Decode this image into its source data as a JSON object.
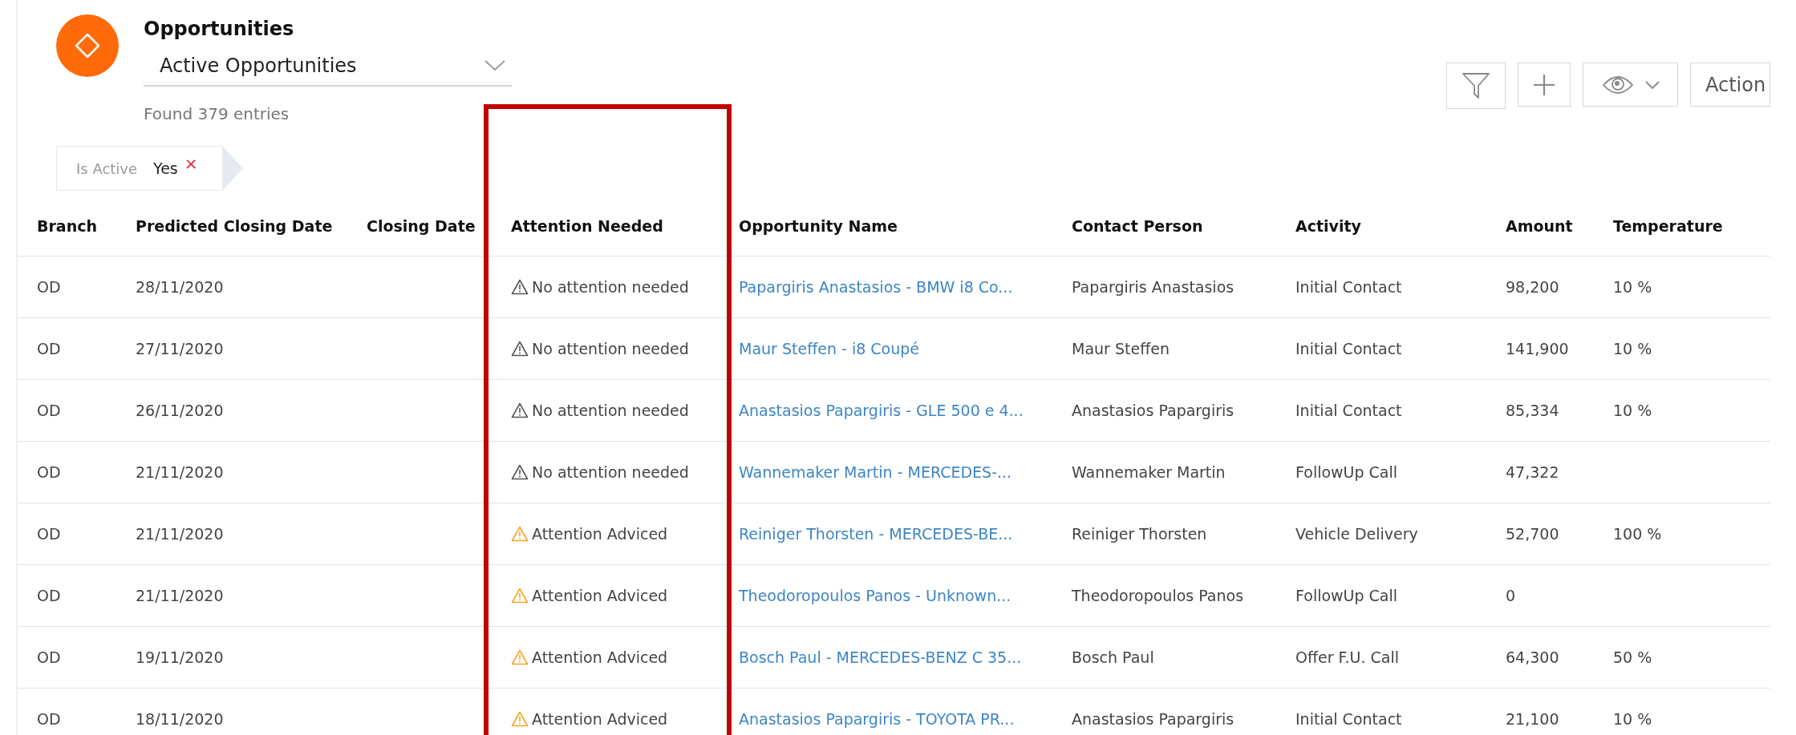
{
  "header": {
    "title": "Opportunities",
    "view": "Active Opportunities",
    "count": "Found 379 entries"
  },
  "toolbar": {
    "actions_label": "Action"
  },
  "filters": [
    {
      "label": "Is Active",
      "value": "Yes",
      "remove": "×"
    }
  ],
  "table": {
    "columns": [
      "Branch",
      "Predicted Closing Date",
      "Closing Date",
      "Attention Needed",
      "Opportunity Name",
      "Contact Person",
      "Activity",
      "Amount",
      "Temperature"
    ],
    "rows": [
      {
        "branch": "OD",
        "predicted": "28/11/2020",
        "closing": "",
        "attention": "No attention needed",
        "kind": "none",
        "name": "Papargiris Anastasios - BMW i8 Co...",
        "contact": "Papargiris Anastasios",
        "activity": "Initial Contact",
        "amount": "98,200",
        "temperature": "10 %"
      },
      {
        "branch": "OD",
        "predicted": "27/11/2020",
        "closing": "",
        "attention": "No attention needed",
        "kind": "none",
        "name": "Maur Steffen - i8 Coupé",
        "contact": "Maur Steffen",
        "activity": "Initial Contact",
        "amount": "141,900",
        "temperature": "10 %"
      },
      {
        "branch": "OD",
        "predicted": "26/11/2020",
        "closing": "",
        "attention": "No attention needed",
        "kind": "none",
        "name": "Anastasios Papargiris - GLE 500 e 4...",
        "contact": "Anastasios Papargiris",
        "activity": "Initial Contact",
        "amount": "85,334",
        "temperature": "10 %"
      },
      {
        "branch": "OD",
        "predicted": "21/11/2020",
        "closing": "",
        "attention": "No attention needed",
        "kind": "none",
        "name": "Wannemaker Martin - MERCEDES-...",
        "contact": "Wannemaker Martin",
        "activity": "FollowUp Call",
        "amount": "47,322",
        "temperature": ""
      },
      {
        "branch": "OD",
        "predicted": "21/11/2020",
        "closing": "",
        "attention": "Attention Adviced",
        "kind": "advised",
        "name": "Reiniger Thorsten - MERCEDES-BE...",
        "contact": "Reiniger Thorsten",
        "activity": "Vehicle Delivery",
        "amount": "52,700",
        "temperature": "100 %"
      },
      {
        "branch": "OD",
        "predicted": "21/11/2020",
        "closing": "",
        "attention": "Attention Adviced",
        "kind": "advised",
        "name": "Theodoropoulos Panos - Unknown...",
        "contact": "Theodoropoulos Panos",
        "activity": "FollowUp Call",
        "amount": "0",
        "temperature": ""
      },
      {
        "branch": "OD",
        "predicted": "19/11/2020",
        "closing": "",
        "attention": "Attention Adviced",
        "kind": "advised",
        "name": "Bosch Paul - MERCEDES-BENZ C 35...",
        "contact": "Bosch Paul",
        "activity": "Offer F.U. Call",
        "amount": "64,300",
        "temperature": "50 %"
      },
      {
        "branch": "OD",
        "predicted": "18/11/2020",
        "closing": "",
        "attention": "Attention Adviced",
        "kind": "advised",
        "name": "Anastasios Papargiris - TOYOTA PR...",
        "contact": "Anastasios Papargiris",
        "activity": "Initial Contact",
        "amount": "21,100",
        "temperature": "10 %"
      }
    ]
  }
}
